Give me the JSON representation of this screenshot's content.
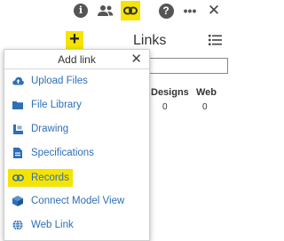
{
  "toolbar": {
    "info_glyph": "i",
    "help_glyph": "?",
    "more_glyph": "•••",
    "close_glyph": "✕",
    "accent": "#f5e400"
  },
  "panel": {
    "add_glyph": "+",
    "title": "Links",
    "columns": [
      {
        "header": "Designs",
        "value": "0"
      },
      {
        "header": "Web",
        "value": "0"
      }
    ]
  },
  "popup": {
    "title": "Add link",
    "close_glyph": "✕",
    "items": [
      {
        "label": "Upload Files",
        "icon": "cloud-upload-icon"
      },
      {
        "label": "File Library",
        "icon": "folder-icon"
      },
      {
        "label": "Drawing",
        "icon": "drawing-icon"
      },
      {
        "label": "Specifications",
        "icon": "document-icon"
      },
      {
        "label": "Records",
        "icon": "link-icon",
        "highlighted": true
      },
      {
        "label": "Connect Model View",
        "icon": "cube-icon"
      },
      {
        "label": "Web Link",
        "icon": "globe-icon"
      }
    ],
    "link_color": "#2e6fb5"
  }
}
